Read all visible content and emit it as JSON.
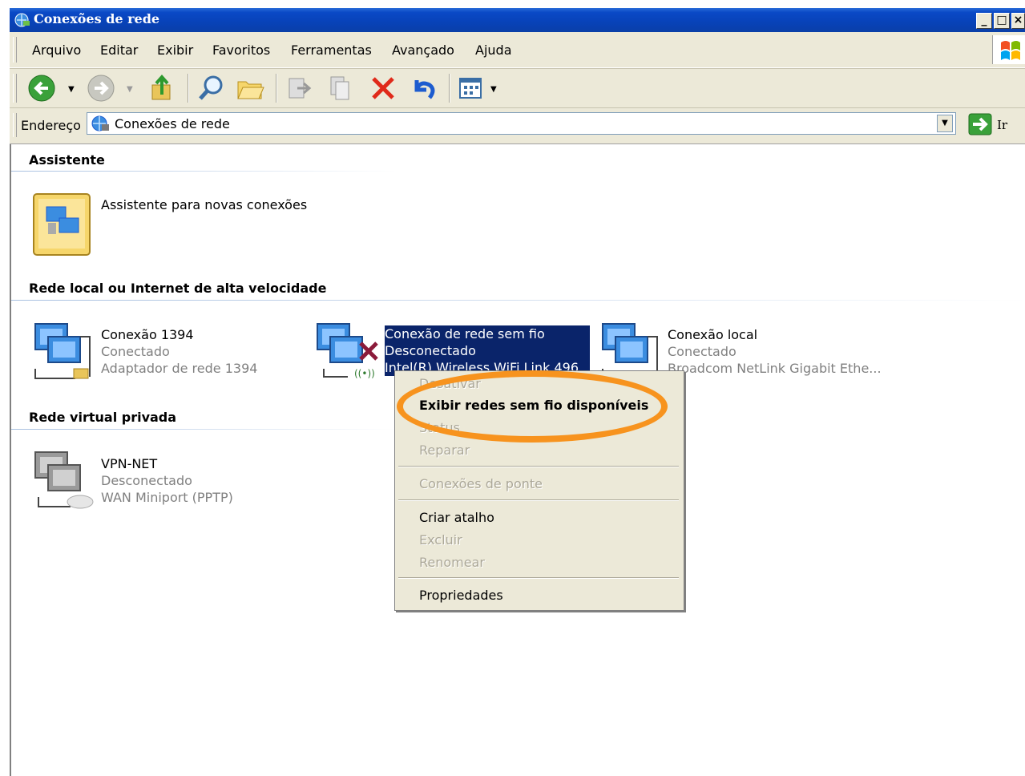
{
  "window": {
    "title": "Conexões de rede"
  },
  "menubar": {
    "items": [
      "Arquivo",
      "Editar",
      "Exibir",
      "Favoritos",
      "Ferramentas",
      "Avançado",
      "Ajuda"
    ]
  },
  "address": {
    "label": "Endereço",
    "value": "Conexões de rede",
    "go_label": "Ir"
  },
  "sections": {
    "wizard": {
      "title": "Assistente",
      "items": [
        {
          "name": "Assistente para novas conexões"
        }
      ]
    },
    "lan": {
      "title": "Rede local ou Internet de alta velocidade",
      "items": [
        {
          "name": "Conexão 1394",
          "status": "Conectado",
          "device": "Adaptador de rede 1394"
        },
        {
          "name": "Conexão de rede sem fio",
          "status": "Desconectado",
          "device": "Intel(R) Wireless WiFi Link 496..."
        },
        {
          "name": "Conexão local",
          "status": "Conectado",
          "device": "Broadcom NetLink Gigabit Ethe..."
        }
      ]
    },
    "vpn": {
      "title": "Rede virtual privada",
      "items": [
        {
          "name": "VPN-NET",
          "status": "Desconectado",
          "device": "WAN Miniport (PPTP)"
        }
      ]
    }
  },
  "context_menu": {
    "items": [
      {
        "label": "Desativar",
        "enabled": false
      },
      {
        "label": "Exibir redes sem fio disponíveis",
        "enabled": true,
        "default": true
      },
      {
        "label": "Status",
        "enabled": false
      },
      {
        "label": "Reparar",
        "enabled": false
      },
      {
        "label": "Conexões de ponte",
        "enabled": false
      },
      {
        "label": "Criar atalho",
        "enabled": true
      },
      {
        "label": "Excluir",
        "enabled": false
      },
      {
        "label": "Renomear",
        "enabled": false
      },
      {
        "label": "Propriedades",
        "enabled": true
      }
    ],
    "highlight_color": "#f7931e"
  },
  "colors": {
    "titlebar": "#0a49c6",
    "selection": "#0a246a",
    "chrome": "#ece9d8"
  }
}
